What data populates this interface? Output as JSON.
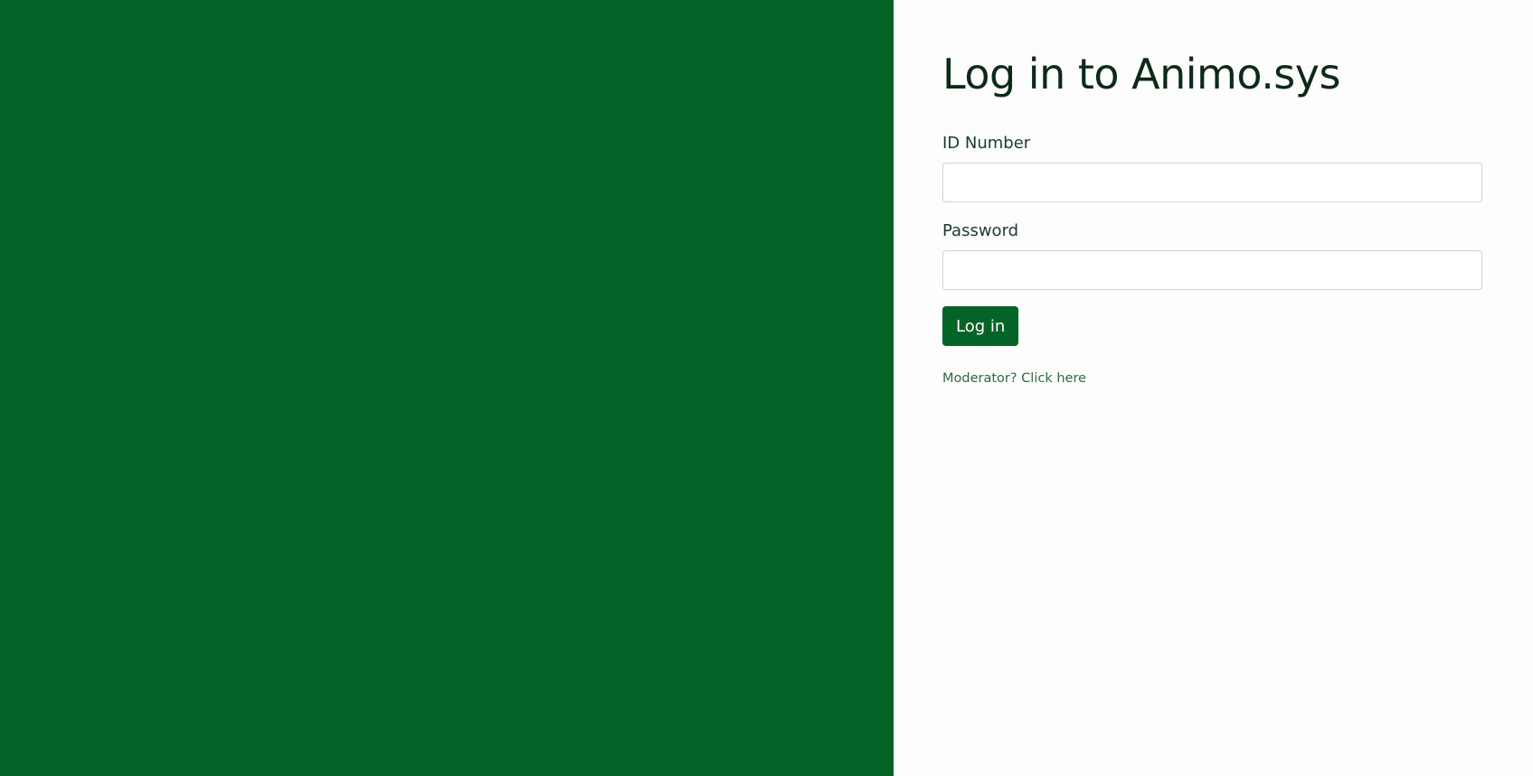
{
  "app": {
    "brand_color": "#046326",
    "panel_background": "#fcfdfc"
  },
  "login": {
    "title": "Log in to Animo.sys",
    "id_label": "ID Number",
    "id_value": "",
    "password_label": "Password",
    "password_value": "",
    "submit_label": "Log in",
    "moderator_link": "Moderator? Click here"
  }
}
